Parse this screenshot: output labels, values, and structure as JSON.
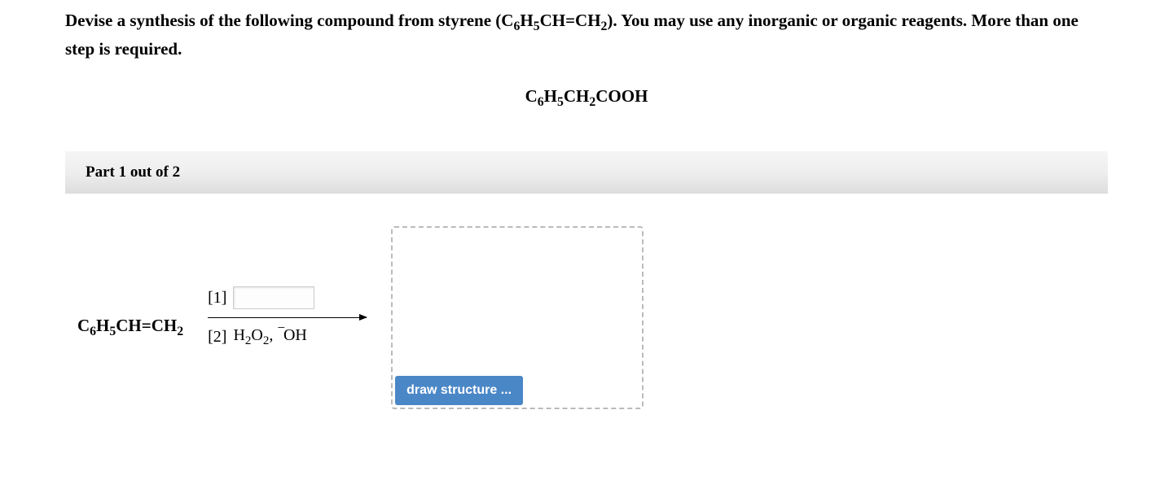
{
  "question": {
    "line1_pre": "Devise a synthesis of the following compound from styrene (",
    "line1_post": "). You may use any inorganic or organic reagents. More than one step is required.",
    "styrene_formula_html": "C<sub>6</sub>H<sub>5</sub>CH=CH<sub>2</sub>"
  },
  "target_compound_html": "C<sub>6</sub>H<sub>5</sub>CH<sub>2</sub>COOH",
  "part_label": "Part 1 out of 2",
  "reaction": {
    "reactant_html": "C<sub>6</sub>H<sub>5</sub>CH=CH<sub>2</sub>",
    "step1_label": "[1]",
    "step2_label": "[2]",
    "step2_reagent_html": "H<sub>2</sub>O<sub>2</sub>, <span class=\"super-minus\">−</span>OH"
  },
  "draw_button": "draw structure ..."
}
